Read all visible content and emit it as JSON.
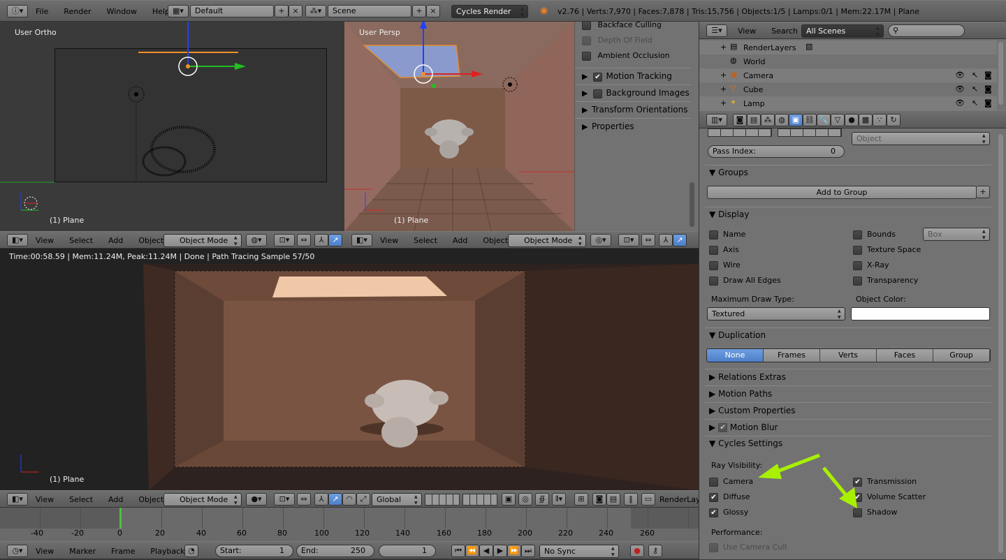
{
  "topbar": {
    "menus": [
      "File",
      "Render",
      "Window",
      "Help"
    ],
    "layout": "Default",
    "scene": "Scene",
    "engine": "Cycles Render",
    "stats": "v2.76 | Verts:7,970 | Faces:7,878 | Tris:15,756 | Objects:1/5 | Lamps:0/1 | Mem:22.17M | Plane"
  },
  "viewport_left": {
    "title": "User Ortho",
    "object": "(1) Plane"
  },
  "viewport_right": {
    "title": "User Persp",
    "object": "(1) Plane"
  },
  "viewport_header": {
    "items": [
      "View",
      "Select",
      "Add",
      "Object"
    ],
    "mode": "Object Mode"
  },
  "nprop": {
    "checks": [
      {
        "label": "Backface Culling",
        "checked": false
      },
      {
        "label": "Depth Of Field",
        "checked": false,
        "disabled": true
      },
      {
        "label": "Ambient Occlusion",
        "checked": false
      }
    ],
    "panels": [
      {
        "label": "Motion Tracking",
        "checkbox": true,
        "checked": true
      },
      {
        "label": "Background Images",
        "checkbox": true,
        "checked": false
      },
      {
        "label": "Transform Orientations",
        "checkbox": false
      },
      {
        "label": "Properties",
        "checkbox": false
      }
    ]
  },
  "render_view": {
    "status": "Time:00:58.59 | Mem:11.24M, Peak:11.24M | Done | Path Tracing Sample 57/50",
    "object": "(1) Plane",
    "header_items": [
      "View",
      "Select",
      "Add",
      "Object"
    ],
    "mode": "Object Mode",
    "orientation": "Global",
    "renderlayer": "RenderLayer"
  },
  "timeline": {
    "ticks": [
      "-40",
      "-20",
      "0",
      "20",
      "40",
      "60",
      "80",
      "100",
      "120",
      "140",
      "160",
      "180",
      "200",
      "220",
      "240",
      "260"
    ],
    "menus": [
      "View",
      "Marker",
      "Frame",
      "Playback"
    ],
    "start_label": "Start:",
    "start": "1",
    "end_label": "End:",
    "end": "250",
    "current": "1",
    "sync": "No Sync"
  },
  "outliner": {
    "menus": [
      "View",
      "Search"
    ],
    "filter": "All Scenes",
    "items": [
      {
        "label": "RenderLayers",
        "indent": 1,
        "icon": "renderlayers-icon"
      },
      {
        "label": "World",
        "indent": 1,
        "icon": "world-icon"
      },
      {
        "label": "Camera",
        "indent": 1,
        "icon": "camera-icon"
      },
      {
        "label": "Cube",
        "indent": 1,
        "icon": "mesh-icon"
      },
      {
        "label": "Lamp",
        "indent": 1,
        "icon": "lamp-icon"
      }
    ]
  },
  "properties": {
    "object_dd": "Object",
    "pass_index_label": "Pass Index:",
    "pass_index": "0",
    "groups_title": "Groups",
    "add_to_group": "Add to Group",
    "display_title": "Display",
    "display_left": [
      {
        "label": "Name",
        "checked": false
      },
      {
        "label": "Axis",
        "checked": false
      },
      {
        "label": "Wire",
        "checked": false
      },
      {
        "label": "Draw All Edges",
        "checked": false
      }
    ],
    "display_right": [
      {
        "label": "Bounds",
        "checked": false
      },
      {
        "label": "Texture Space",
        "checked": false
      },
      {
        "label": "X-Ray",
        "checked": false
      },
      {
        "label": "Transparency",
        "checked": false
      }
    ],
    "bounds_type": "Box",
    "max_draw_type_label": "Maximum Draw Type:",
    "max_draw_type": "Textured",
    "object_color_label": "Object Color:",
    "duplication_title": "Duplication",
    "duplication_options": [
      "None",
      "Frames",
      "Verts",
      "Faces",
      "Group"
    ],
    "duplication_selected": "None",
    "collapsed_panels": [
      "Relations Extras",
      "Motion Paths",
      "Custom Properties"
    ],
    "motion_blur": "Motion Blur",
    "cycles_title": "Cycles Settings",
    "ray_visibility_label": "Ray Visibility:",
    "ray_left": [
      {
        "label": "Camera",
        "checked": false
      },
      {
        "label": "Diffuse",
        "checked": true
      },
      {
        "label": "Glossy",
        "checked": true
      }
    ],
    "ray_right": [
      {
        "label": "Transmission",
        "checked": true
      },
      {
        "label": "Volume Scatter",
        "checked": true
      },
      {
        "label": "Shadow",
        "checked": false
      }
    ],
    "performance_label": "Performance:",
    "use_camera_cull": "Use Camera Cull"
  },
  "colors": {
    "accent": "#5680c2",
    "arrow": "#a8f000",
    "selected": "#f0902a"
  }
}
